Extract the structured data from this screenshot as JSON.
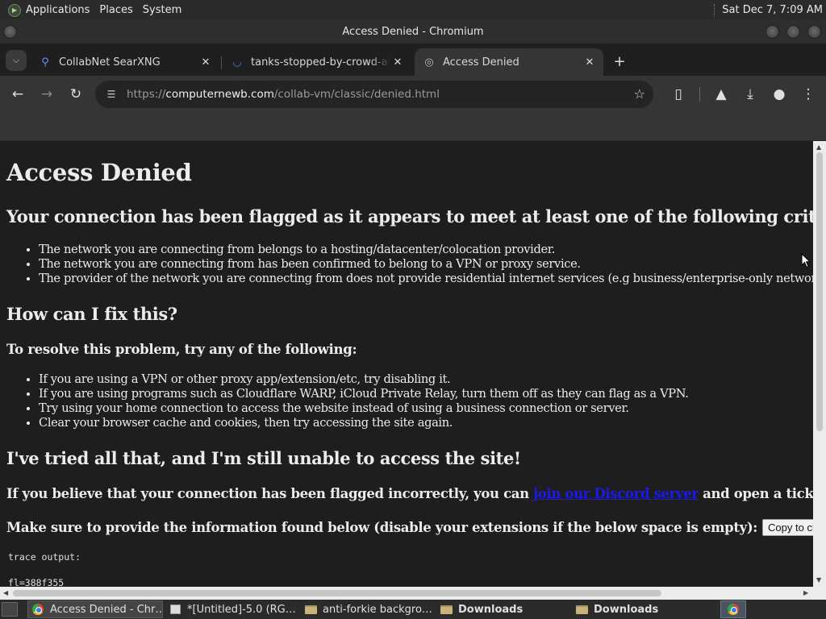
{
  "top_panel": {
    "menus": [
      "Applications",
      "Places",
      "System"
    ],
    "clock": "Sat Dec  7, 7:09 AM"
  },
  "window": {
    "title": "Access Denied - Chromium"
  },
  "tabs": [
    {
      "title": "CollabNet SearXNG",
      "icon": "search-icon",
      "active": false
    },
    {
      "title": "tanks-stopped-by-crowd-at-",
      "icon": "loading-icon",
      "active": false
    },
    {
      "title": "Access Denied",
      "icon": "globe-icon",
      "active": true
    }
  ],
  "address_bar": {
    "scheme": "https://",
    "host": "computernewb.com",
    "path": "/collab-vm/classic/denied.html"
  },
  "page": {
    "title": "Access Denied",
    "criteria_heading": "Your connection has been flagged as it appears to meet at least one of the following criteria:",
    "criteria": [
      "The network you are connecting from belongs to a hosting/datacenter/colocation provider.",
      "The network you are connecting from has been confirmed to belong to a VPN or proxy service.",
      "The provider of the network you are connecting from does not provide residential internet services (e.g business/enterprise-only networks)."
    ],
    "fix_heading": "How can I fix this?",
    "resolve_heading": "To resolve this problem, try any of the following:",
    "fixes": [
      "If you are using a VPN or other proxy app/extension/etc, try disabling it.",
      "If you are using programs such as Cloudflare WARP, iCloud Private Relay, turn them off as they can flag as a VPN.",
      "Try using your home connection to access the website instead of using a business connection or server.",
      "Clear your browser cache and cookies, then try accessing the site again."
    ],
    "tried_heading": "I've tried all that, and I'm still unable to access the site!",
    "believe_prefix": "If you believe that your connection has been flagged incorrectly, you can",
    "believe_link": "join our Discord server",
    "believe_suffix": "and open a ticket.",
    "provide_text": "Make sure to provide the information found below (disable your extensions if the below space is empty):",
    "copy_button": "Copy to clipboard",
    "trace_label": "trace output:",
    "trace_line": "fl=388f355"
  },
  "taskbar": {
    "items": [
      {
        "label": "Access Denied - Chr…",
        "icon": "chromium-icon",
        "active": true
      },
      {
        "label": "*[Untitled]-5.0 (RG…",
        "icon": "image-editor-icon",
        "active": false
      },
      {
        "label": "anti-forkie backgro…",
        "icon": "folder-icon",
        "active": false
      },
      {
        "label": "Downloads",
        "icon": "folder-icon",
        "active": false
      },
      {
        "label": "Downloads",
        "icon": "folder-icon",
        "active": false
      }
    ]
  }
}
